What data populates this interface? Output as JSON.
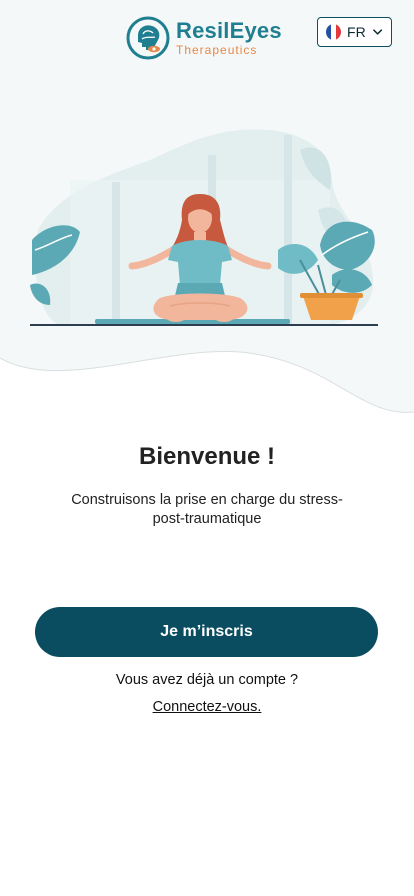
{
  "header": {
    "logo_name": "ResilEyes",
    "logo_subtitle": "Therapeutics",
    "language": {
      "label": "FR",
      "flag": "france-flag-icon"
    }
  },
  "main": {
    "title": "Bienvenue !",
    "subtitle": "Construisons la prise en charge du stress-post-traumatique",
    "signup_button": "Je m’inscris",
    "have_account_text": "Vous avez déjà un compte ?",
    "login_link": "Connectez-vous."
  },
  "colors": {
    "primary": "#0a4d61",
    "logo_teal": "#1f7f90",
    "logo_orange": "#e4894a",
    "leaf_teal": "#5aa9b5",
    "pot_orange": "#f0a14a",
    "hair": "#c75a3e"
  }
}
